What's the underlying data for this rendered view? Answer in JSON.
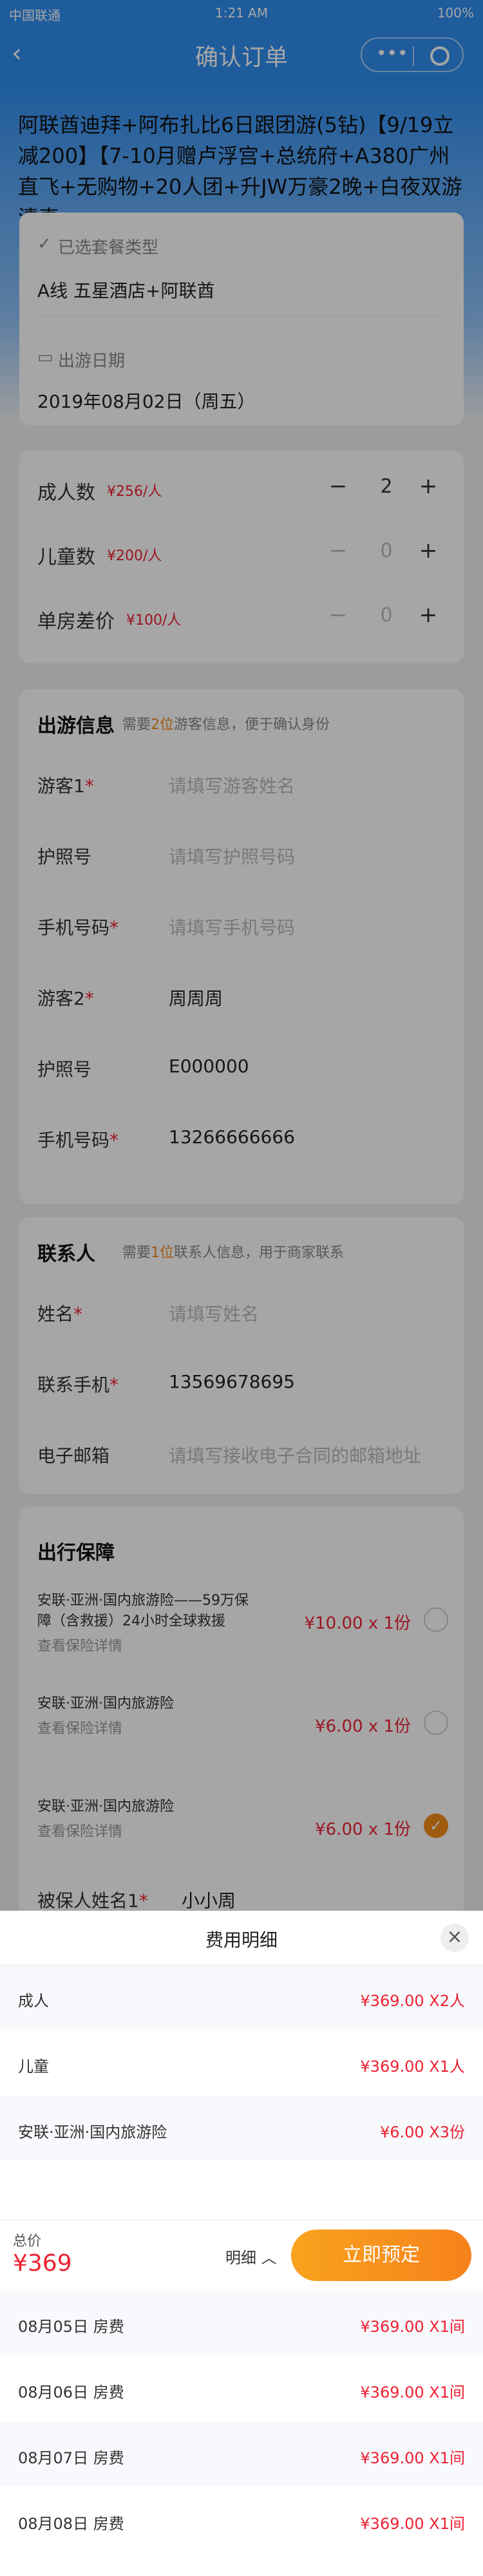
{
  "status_bar": {
    "carrier": "中国联通",
    "time": "1:21 AM",
    "battery": "100%"
  },
  "nav": {
    "back_icon": "‹",
    "title": "确认订单",
    "more_icon": "•••"
  },
  "product": {
    "name": "阿联酋迪拜+阿布扎比6日跟团游(5钻)【9/19立减200】【7-10月赠卢浮宫+总统府+A380广州直飞+无购物+20人团+升JW万豪2晚+白夜双游清真"
  },
  "package": {
    "label": "已选套餐类型",
    "value": "A线 五星酒店+阿联酋"
  },
  "date": {
    "label": "出游日期",
    "value": "2019年08月02日（周五）"
  },
  "counts": [
    {
      "label": "成人数",
      "price": "¥256/人",
      "qty": "2"
    },
    {
      "label": "儿童数",
      "price": "¥200/人",
      "qty": "0"
    },
    {
      "label": "单房差价",
      "price": "¥100/人",
      "qty": "0"
    }
  ],
  "travelers": {
    "title": "出游信息",
    "hint_pre": "需要",
    "hint_num": "2位",
    "hint_post": "游客信息，便于确认身份",
    "fields": [
      {
        "label": "游客1",
        "req": "*",
        "placeholder": "请填写游客姓名",
        "value": ""
      },
      {
        "label": "护照号",
        "req": "",
        "placeholder": "请填写护照号码",
        "value": ""
      },
      {
        "label": "手机号码",
        "req": "*",
        "placeholder": "请填写手机号码",
        "value": ""
      },
      {
        "label": "游客2",
        "req": "*",
        "placeholder": "",
        "value": "周周周"
      },
      {
        "label": "护照号",
        "req": "",
        "placeholder": "",
        "value": "E000000"
      },
      {
        "label": "手机号码",
        "req": "*",
        "placeholder": "",
        "value": "13266666666"
      }
    ]
  },
  "contact": {
    "title": "联系人",
    "hint_pre": "需要",
    "hint_num": "1位",
    "hint_post": "联系人信息，用于商家联系",
    "fields": [
      {
        "label": "姓名",
        "req": "*",
        "placeholder": "请填写姓名",
        "value": ""
      },
      {
        "label": "联系手机",
        "req": "*",
        "placeholder": "",
        "value": "13569678695"
      },
      {
        "label": "电子邮箱",
        "req": "",
        "placeholder": "请填写接收电子合同的邮箱地址",
        "value": ""
      }
    ]
  },
  "insurance": {
    "title": "出行保障",
    "items": [
      {
        "name": "安联·亚洲·国内旅游险——59万保障（含救援）24小时全球救援",
        "link": "查看保险详情",
        "price": "¥10.00 x 1份",
        "checked": false
      },
      {
        "name": "安联·亚洲·国内旅游险",
        "link": "查看保险详情",
        "price": "¥6.00 x 1份",
        "checked": false
      },
      {
        "name": "安联·亚洲·国内旅游险",
        "link": "查看保险详情",
        "price": "¥6.00 x 1份",
        "checked": true
      }
    ],
    "insured_label": "被保人姓名1",
    "insured_req": "*",
    "insured_value": "小小周"
  },
  "sheet": {
    "title": "费用明细",
    "close_icon": "×",
    "rows_top": [
      {
        "a": "成人",
        "b": "¥369.00  X2人"
      },
      {
        "a": "儿童",
        "b": "¥369.00  X1人"
      },
      {
        "a": "安联·亚洲·国内旅游险",
        "b": "¥6.00  X3份"
      }
    ],
    "rows_bottom": [
      {
        "a": "08月05日  房费",
        "b": "¥369.00  X1间"
      },
      {
        "a": "08月06日  房费",
        "b": "¥369.00  X1间"
      },
      {
        "a": "08月07日  房费",
        "b": "¥369.00  X1间"
      },
      {
        "a": "08月08日  房费",
        "b": "¥369.00  X1间"
      }
    ]
  },
  "footer": {
    "total_label": "总价",
    "total": "¥369",
    "detail": "明细",
    "detail_icon": "︿",
    "book": "立即预定"
  }
}
